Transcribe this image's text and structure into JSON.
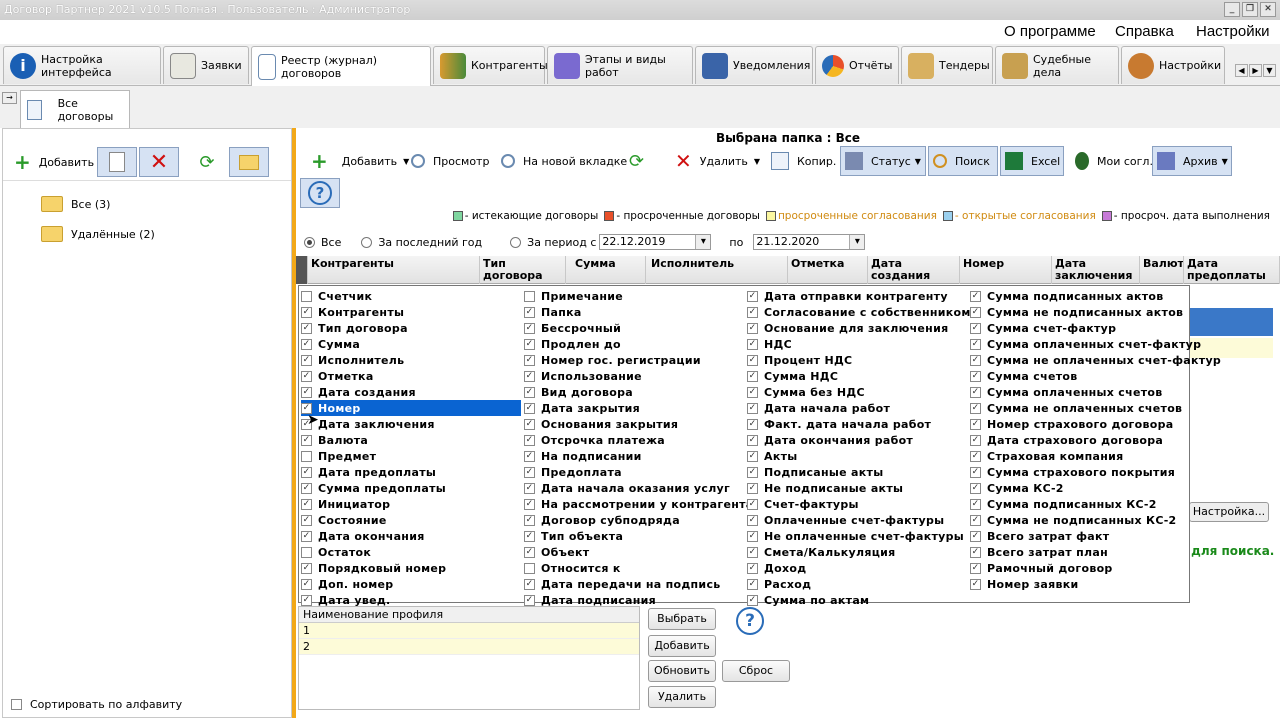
{
  "window": {
    "title": "Договор Партнер 2021 v10.5 Полная . Пользователь : Администратор"
  },
  "menu": [
    "О программе",
    "Справка",
    "Настройки"
  ],
  "tabs": [
    "Настройка интерфейса",
    "Заявки",
    "Реестр (журнал) договоров",
    "Контрагенты",
    "Этапы и виды работ",
    "Уведомления",
    "Отчёты",
    "Тендеры",
    "Судебные дела",
    "Настройки"
  ],
  "subtab": "Все договоры",
  "left": {
    "add_label": "Добавить",
    "tree": [
      "Все (3)",
      "Удалённые (2)"
    ],
    "sort_label": "Сортировать по алфавиту"
  },
  "main": {
    "header": "Выбрана папка : Все",
    "toolbar": {
      "add": "Добавить",
      "view": "Просмотр",
      "newtab": "На новой вкладке",
      "delete": "Удалить",
      "copy": "Копир.",
      "status": "Статус",
      "search": "Поиск",
      "excel": "Excel",
      "mine": "Мои согл.",
      "archive": "Архив"
    },
    "legend": [
      {
        "label": "- истекающие договоры",
        "color": "#7fd6a0",
        "text_color": "#000"
      },
      {
        "label": "- просроченные договоры",
        "color": "#e8502a",
        "text_color": "#000"
      },
      {
        "label": "просроченные согласования",
        "color": "#fbf7a0",
        "text_color": "#d08a10"
      },
      {
        "label": "- открытые согласования",
        "color": "#9bd0ee",
        "text_color": "#d08a10"
      },
      {
        "label": "- просроч. дата выполнения",
        "color": "#c77ad8",
        "text_color": "#000"
      }
    ],
    "filters": {
      "all": "Все",
      "last_year": "За последний год",
      "period": "За период с",
      "date_from": "22.12.2019",
      "po": "по",
      "date_to": "21.12.2020"
    },
    "columns": [
      "Контрагенты",
      "Тип договора",
      "Сумма",
      "Исполнитель",
      "Отметка",
      "Дата создания",
      "Номер",
      "Дата заключения",
      "Валюта",
      "Дата предоплаты"
    ],
    "settings_btn": "Настройка...",
    "green_hint": "т для поиска."
  },
  "chooser": {
    "col1": [
      [
        "Счетчик",
        false
      ],
      [
        "Контрагенты",
        true
      ],
      [
        "Тип договора",
        true
      ],
      [
        "Сумма",
        true
      ],
      [
        "Исполнитель",
        true
      ],
      [
        "Отметка",
        true
      ],
      [
        "Дата создания",
        true
      ],
      [
        "Номер",
        true
      ],
      [
        "Дата заключения",
        true
      ],
      [
        "Валюта",
        true
      ],
      [
        "Предмет",
        false
      ],
      [
        "Дата предоплаты",
        true
      ],
      [
        "Сумма предоплаты",
        true
      ],
      [
        "Инициатор",
        true
      ],
      [
        "Состояние",
        true
      ],
      [
        "Дата окончания",
        true
      ],
      [
        "Остаток",
        false
      ],
      [
        "Порядковый номер",
        true
      ],
      [
        "Доп. номер",
        true
      ],
      [
        "Дата увед.",
        true
      ]
    ],
    "col2": [
      [
        "Примечание",
        false
      ],
      [
        "Папка",
        true
      ],
      [
        "Бессрочный",
        true
      ],
      [
        "Продлен до",
        true
      ],
      [
        "Номер гос. регистрации",
        true
      ],
      [
        "Использование",
        true
      ],
      [
        "Вид договора",
        true
      ],
      [
        "Дата закрытия",
        true
      ],
      [
        "Основания закрытия",
        true
      ],
      [
        "Отсрочка платежа",
        true
      ],
      [
        "На подписании",
        true
      ],
      [
        "Предоплата",
        true
      ],
      [
        "Дата начала оказания услуг",
        true
      ],
      [
        "На рассмотрении у контрагента",
        true
      ],
      [
        "Договор субподряда",
        true
      ],
      [
        "Тип объекта",
        true
      ],
      [
        "Объект",
        true
      ],
      [
        "Относится к",
        false
      ],
      [
        "Дата передачи на подпись",
        true
      ],
      [
        "Дата подписания",
        true
      ]
    ],
    "col3": [
      [
        "Дата отправки контрагенту",
        true
      ],
      [
        "Согласование с собственником",
        true
      ],
      [
        "Основание для заключения",
        true
      ],
      [
        "НДС",
        true
      ],
      [
        "Процент НДС",
        true
      ],
      [
        "Сумма НДС",
        true
      ],
      [
        "Сумма без НДС",
        true
      ],
      [
        "Дата начала работ",
        true
      ],
      [
        "Факт. дата начала работ",
        true
      ],
      [
        "Дата окончания работ",
        true
      ],
      [
        "Акты",
        true
      ],
      [
        "Подписаные акты",
        true
      ],
      [
        "Не подписаные акты",
        true
      ],
      [
        "Счет-фактуры",
        true
      ],
      [
        "Оплаченные счет-фактуры",
        true
      ],
      [
        "Не оплаченные счет-фактуры",
        true
      ],
      [
        "Смета/Калькуляция",
        true
      ],
      [
        "Доход",
        true
      ],
      [
        "Расход",
        true
      ],
      [
        "Сумма по актам",
        true
      ]
    ],
    "col4": [
      [
        "Сумма подписанных актов",
        true
      ],
      [
        "Сумма не подписанных актов",
        true
      ],
      [
        "Сумма счет-фактур",
        true
      ],
      [
        "Сумма оплаченных счет-фактур",
        true
      ],
      [
        "Сумма не оплаченных счет-фактур",
        true
      ],
      [
        "Сумма счетов",
        true
      ],
      [
        "Сумма оплаченных счетов",
        true
      ],
      [
        "Сумма не оплаченных счетов",
        true
      ],
      [
        "Номер страхового договора",
        true
      ],
      [
        "Дата страхового договора",
        true
      ],
      [
        "Страховая компания",
        true
      ],
      [
        "Сумма страхового покрытия",
        true
      ],
      [
        "Сумма КС-2",
        true
      ],
      [
        "Сумма подписанных КС-2",
        true
      ],
      [
        "Сумма не подписанных КС-2",
        true
      ],
      [
        "Всего затрат факт",
        true
      ],
      [
        "Всего затрат план",
        true
      ],
      [
        "Рамочный договор",
        true
      ],
      [
        "Номер заявки",
        true
      ]
    ]
  },
  "profiles": {
    "header": "Наименование профиля",
    "rows": [
      "1",
      "2"
    ],
    "buttons": {
      "choose": "Выбрать",
      "add": "Добавить",
      "refresh": "Обновить",
      "reset": "Сброс",
      "delete": "Удалить"
    }
  }
}
